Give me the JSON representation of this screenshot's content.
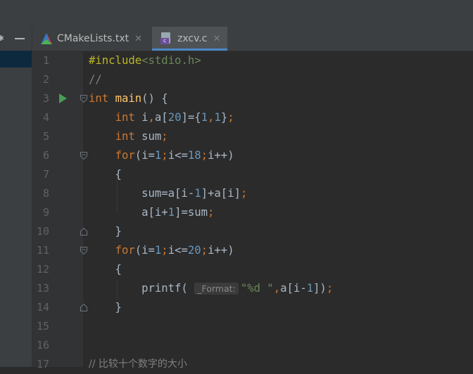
{
  "tabs": [
    {
      "label": "CMakeLists.txt",
      "active": false,
      "icon": "cmake-icon"
    },
    {
      "label": "zxcv.c",
      "active": true,
      "icon": "c-file-icon"
    }
  ],
  "editor": {
    "lines": [
      {
        "number": "1"
      },
      {
        "number": "2"
      },
      {
        "number": "3"
      },
      {
        "number": "4"
      },
      {
        "number": "5"
      },
      {
        "number": "6"
      },
      {
        "number": "7"
      },
      {
        "number": "8"
      },
      {
        "number": "9"
      },
      {
        "number": "10"
      },
      {
        "number": "11"
      },
      {
        "number": "12"
      },
      {
        "number": "13"
      },
      {
        "number": "14"
      },
      {
        "number": "15"
      },
      {
        "number": "16"
      },
      {
        "number": "17"
      }
    ],
    "parameter_hint": "_Format:",
    "trailing_comment_partial": "// 比较十个数字的大小"
  },
  "colors": {
    "background": "#2b2b2b",
    "keyword": "#cc7832",
    "number": "#6897bb",
    "string": "#6a8759",
    "function": "#ffc66d",
    "preprocessor": "#bbb529",
    "run": "#499c54",
    "tab_accent": "#4a88c7"
  }
}
